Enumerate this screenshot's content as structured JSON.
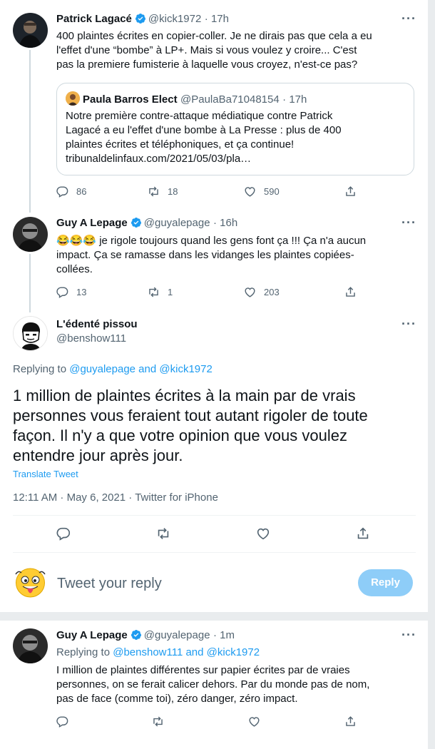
{
  "tweet1": {
    "name": "Patrick Lagacé",
    "handle": "@kick1972",
    "time": "· 17h",
    "text_lines": [
      "400 plaintes écrites en copier-coller. Je ne dirais pas que cela a eu",
      "l'effet d'une “bombe” à LP+. Mais si vous voulez y croire... C'est",
      "pas la premiere fumisterie à laquelle vous croyez, n'est-ce pas?"
    ],
    "quote": {
      "name": "Paula Barros Elect",
      "handle": "@PaulaBa71048154",
      "time": "· 17h",
      "text_lines": [
        "Notre première contre-attaque médiatique contre Patrick",
        "Lagacé a eu l'effet d'une bombe à La Presse : plus de 400",
        "plaintes écrites et téléphoniques, et ça continue!",
        "tribunaldelinfaux.com/2021/05/03/pla…"
      ]
    },
    "replies": "86",
    "retweets": "18",
    "likes": "590"
  },
  "tweet2": {
    "name": "Guy A Lepage",
    "handle": "@guyalepage",
    "time": "· 16h",
    "emoji": "😂😂😂",
    "text_lines": [
      " je rigole toujours quand les gens font ça !!! Ça n'a aucun",
      "impact. Ça se ramasse dans les vidanges les plaintes copiées-",
      "collées."
    ],
    "replies": "13",
    "retweets": "1",
    "likes": "203"
  },
  "main": {
    "name": "L'édenté pissou",
    "handle": "@benshow111",
    "replying_prefix": "Replying to ",
    "replying_to": "@guyalepage and @kick1972",
    "text_lines": [
      "1 million de plaintes écrites à la main par de vrais",
      "personnes vous feraient tout autant rigoler de toute",
      "façon. Il n'y a que votre opinion que vous voulez",
      "entendre jour après jour."
    ],
    "translate": "Translate Tweet",
    "meta": "12:11 AM · May 6, 2021 · Twitter for iPhone"
  },
  "compose": {
    "placeholder": "Tweet your reply",
    "reply_label": "Reply"
  },
  "tweet3": {
    "name": "Guy A Lepage",
    "handle": "@guyalepage",
    "time": "· 1m",
    "replying_prefix": "Replying to ",
    "replying_to": "@benshow111 and @kick1972",
    "text_lines": [
      "I million de plaintes différentes sur papier écrites par de vraies",
      "personnes, on se ferait calicer dehors. Par du monde pas de nom,",
      "pas de face (comme toi), zéro danger, zéro impact."
    ]
  },
  "icons": {
    "more": "more-icon",
    "reply": "reply-icon",
    "retweet": "retweet-icon",
    "like": "like-icon",
    "share": "share-icon",
    "verified": "verified-badge-icon"
  },
  "colors": {
    "accent": "#1d9bf0",
    "reply_button_disabled": "#8ecdf8",
    "muted": "#536471"
  }
}
